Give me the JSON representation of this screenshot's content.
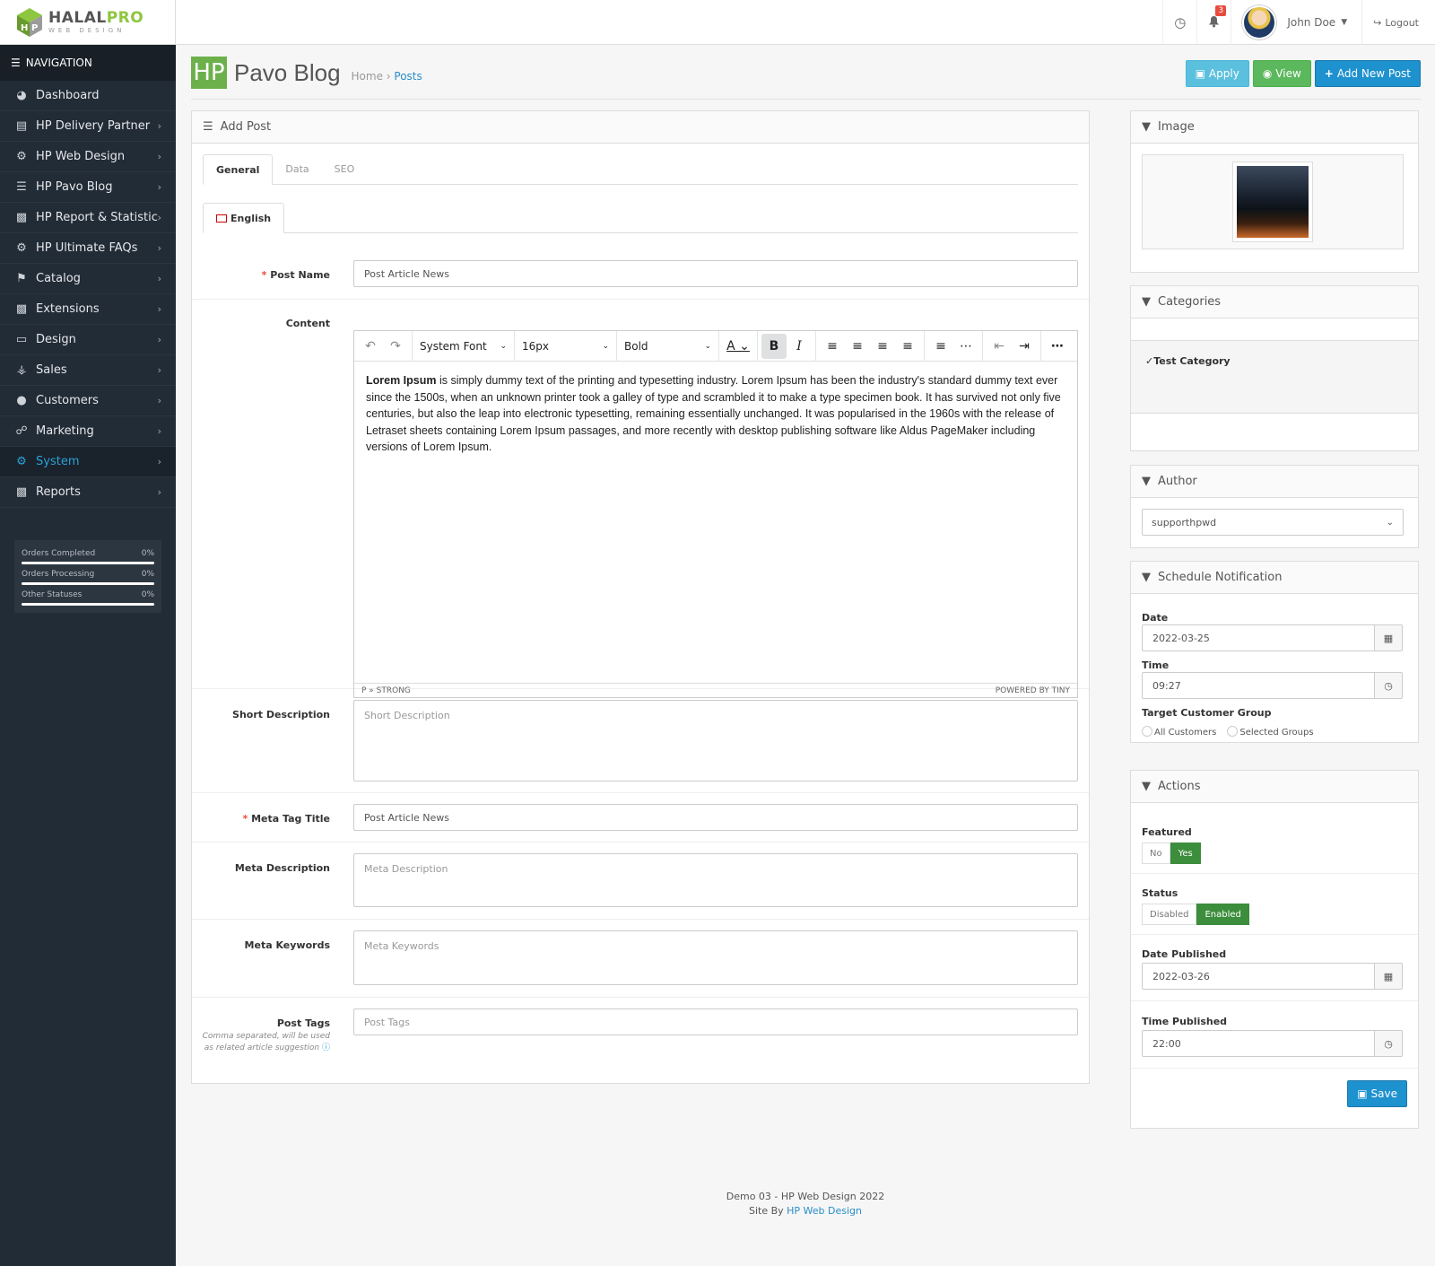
{
  "brand": {
    "name_a": "HALAL",
    "name_b": "PRO",
    "tagline": "WEB DESIGN"
  },
  "header": {
    "notif_count": "3",
    "user": "John Doe",
    "logout": "Logout"
  },
  "nav": {
    "title": "NAVIGATION",
    "items": [
      {
        "label": "Dashboard",
        "icon": "dashboard-icon"
      },
      {
        "label": "HP Delivery Partner",
        "icon": "credit-card-icon"
      },
      {
        "label": "HP Web Design",
        "icon": "cogs-icon"
      },
      {
        "label": "HP Pavo Blog",
        "icon": "list-icon"
      },
      {
        "label": "HP Report & Statistic",
        "icon": "bar-chart-icon"
      },
      {
        "label": "HP Ultimate FAQs",
        "icon": "cogs-icon"
      },
      {
        "label": "Catalog",
        "icon": "tags-icon"
      },
      {
        "label": "Extensions",
        "icon": "puzzle-icon"
      },
      {
        "label": "Design",
        "icon": "desktop-icon"
      },
      {
        "label": "Sales",
        "icon": "cart-icon"
      },
      {
        "label": "Customers",
        "icon": "user-icon"
      },
      {
        "label": "Marketing",
        "icon": "share-icon"
      },
      {
        "label": "System",
        "icon": "gear-icon"
      },
      {
        "label": "Reports",
        "icon": "bar-chart-icon"
      }
    ],
    "stats": [
      {
        "label": "Orders Completed",
        "value": "0%"
      },
      {
        "label": "Orders Processing",
        "value": "0%"
      },
      {
        "label": "Other Statuses",
        "value": "0%"
      }
    ]
  },
  "page": {
    "badge": "HP",
    "title": "Pavo Blog",
    "bc_home": "Home",
    "bc_current": "Posts",
    "btn_apply": "Apply",
    "btn_view": "View",
    "btn_add": "Add New Post"
  },
  "form": {
    "panel_title": "Add Post",
    "tab_general": "General",
    "tab_data": "Data",
    "tab_seo": "SEO",
    "lang": "English",
    "post_name_label": "Post Name",
    "post_name_value": "Post Article News",
    "content_label": "Content",
    "toolbar": {
      "font": "System Font",
      "size": "16px",
      "format": "Bold"
    },
    "content_strong": "Lorem Ipsum",
    "content_text": " is simply dummy text of the printing and typesetting industry. Lorem Ipsum has been the industry's standard dummy text ever since the 1500s, when an unknown printer took a galley of type and scrambled it to make a type specimen book. It has survived not only five centuries, but also the leap into electronic typesetting, remaining essentially unchanged. It was popularised in the 1960s with the release of Letraset sheets containing Lorem Ipsum passages, and more recently with desktop publishing software like Aldus PageMaker including versions of Lorem Ipsum.",
    "status_path": "P » STRONG",
    "powered": "POWERED BY TINY",
    "short_desc_label": "Short Description",
    "short_desc_ph": "Short Description",
    "meta_title_label": "Meta Tag Title",
    "meta_title_value": "Post Article News",
    "meta_desc_label": "Meta Description",
    "meta_desc_ph": "Meta Description",
    "meta_kw_label": "Meta Keywords",
    "meta_kw_ph": "Meta Keywords",
    "tags_label": "Post Tags",
    "tags_help": "Comma separated, will be used as related article suggestion",
    "tags_ph": "Post Tags"
  },
  "sidebar_right": {
    "image_title": "Image",
    "categories_title": "Categories",
    "category": "Test Category",
    "author_title": "Author",
    "author": "supporthpwd",
    "schedule_title": "Schedule Notification",
    "date_label": "Date",
    "date": "2022-03-25",
    "time_label": "Time",
    "time": "09:27",
    "target_label": "Target Customer Group",
    "opt_all": "All Customers",
    "opt_selected": "Selected Groups",
    "actions_title": "Actions",
    "featured_label": "Featured",
    "no": "No",
    "yes": "Yes",
    "status_label": "Status",
    "disabled": "Disabled",
    "enabled": "Enabled",
    "date_pub_label": "Date Published",
    "date_pub": "2022-03-26",
    "time_pub_label": "Time Published",
    "time_pub": "22:00",
    "save": "Save"
  },
  "footer": {
    "line1": "Demo 03 - HP Web Design 2022",
    "line2": "Site By ",
    "link": "HP Web Design"
  },
  "colors": {
    "accent": "#1e91cf",
    "sidebar": "#222c37",
    "success": "#3c8d3c"
  }
}
